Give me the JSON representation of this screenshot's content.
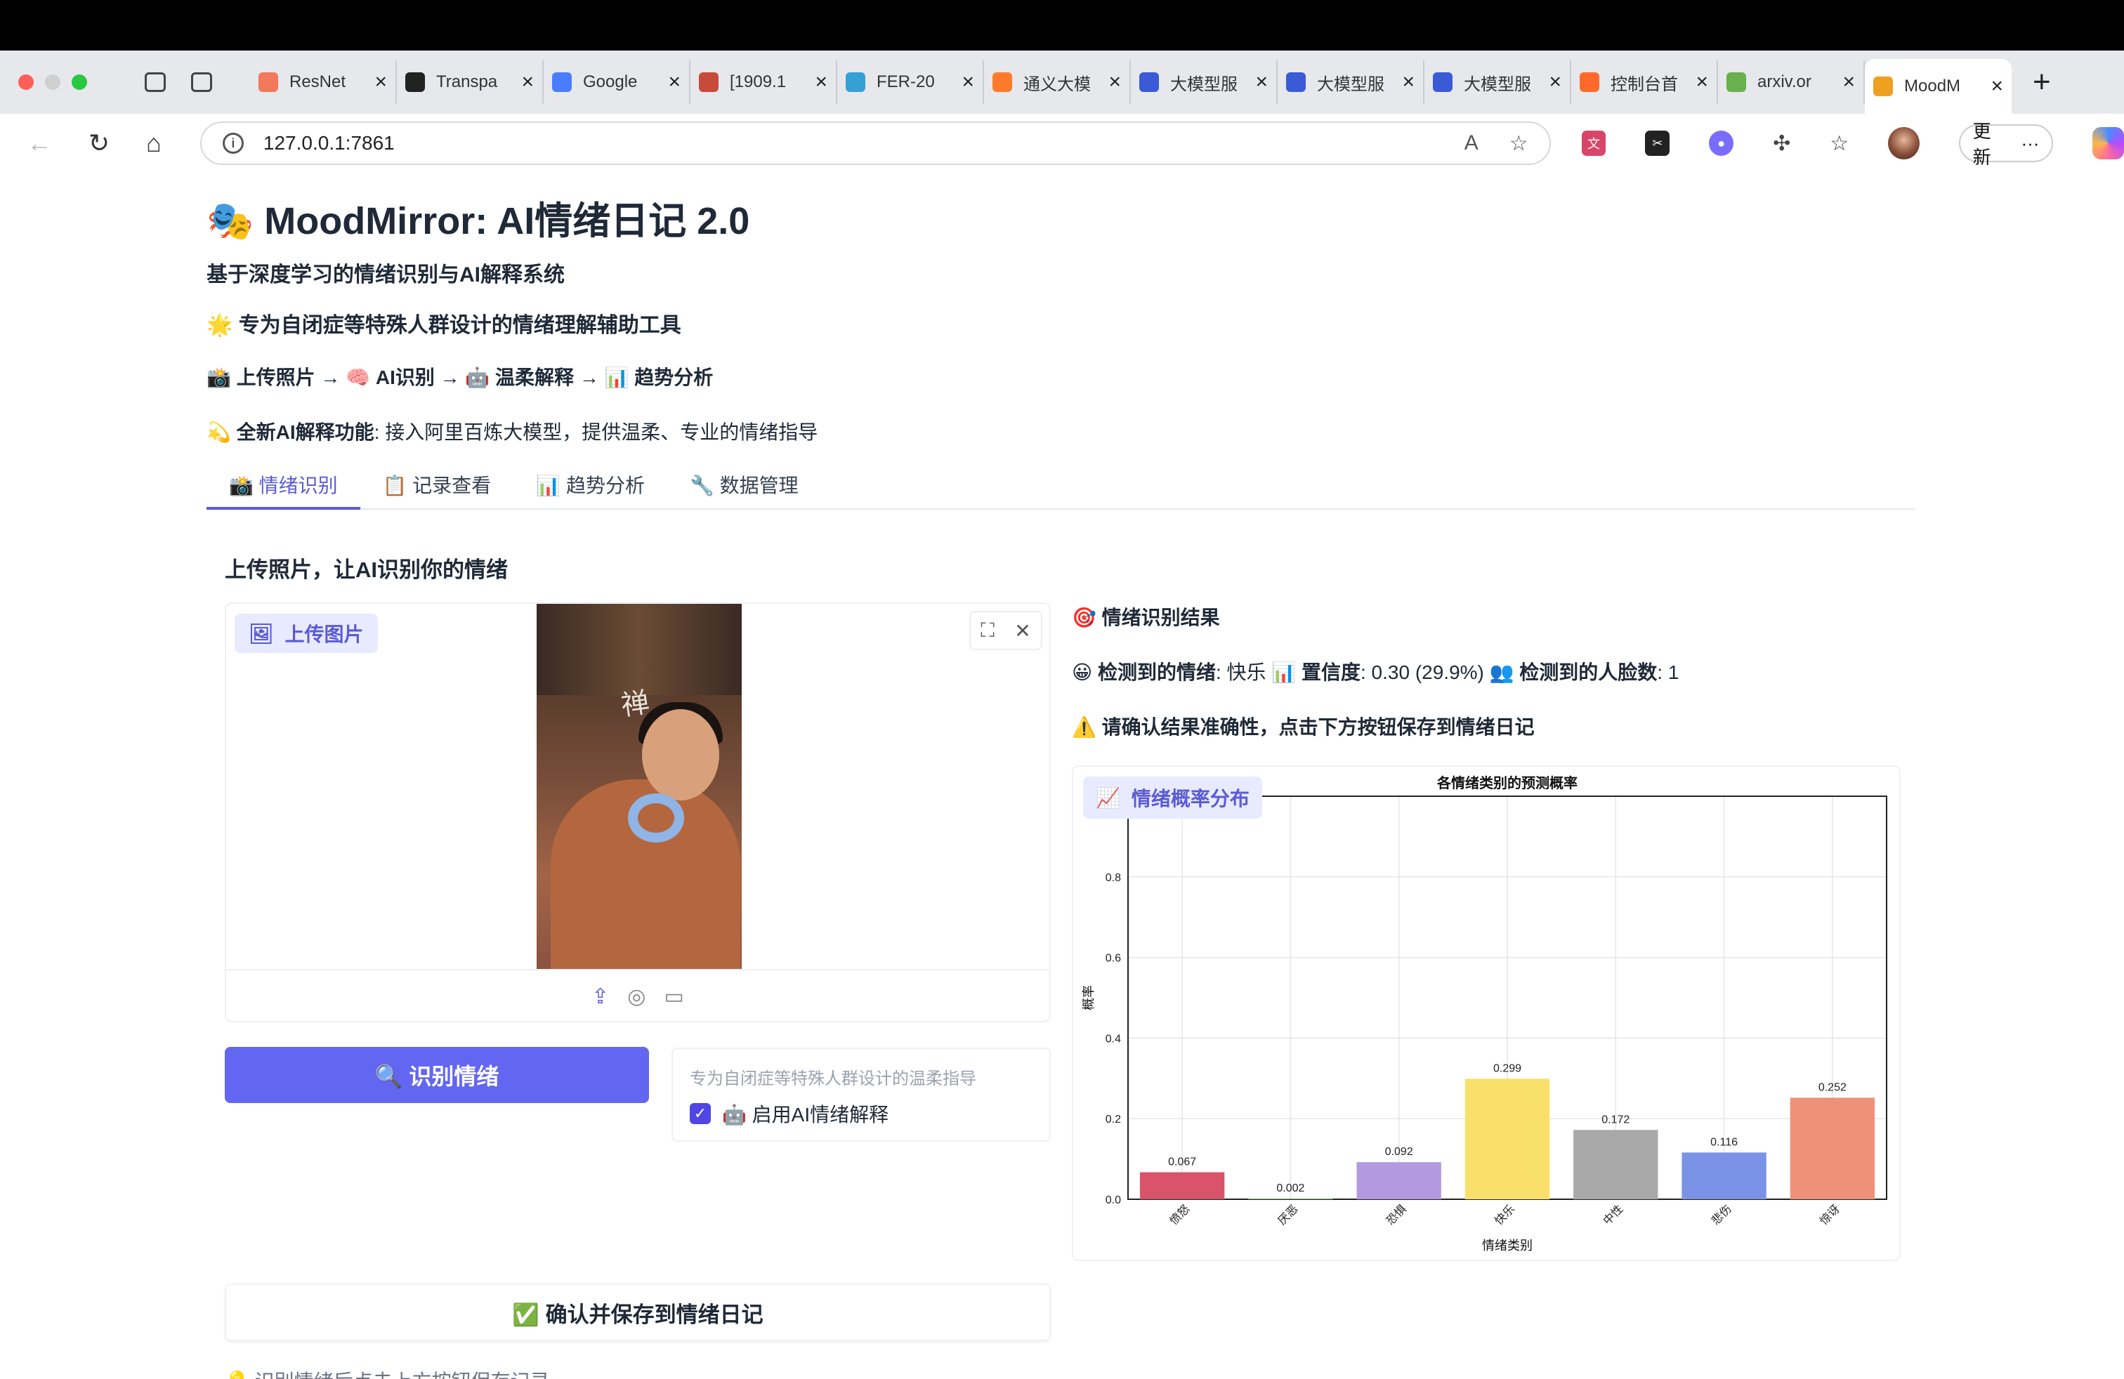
{
  "browser": {
    "tabs": [
      {
        "label": "ResNet",
        "color": "#f07a5a",
        "icon": "C"
      },
      {
        "label": "Transpa",
        "color": "#222222",
        "icon": "github"
      },
      {
        "label": "Google",
        "color": "#4a7cff",
        "icon": "spark"
      },
      {
        "label": "[1909.1",
        "color": "#c84a3a",
        "icon": "arxiv"
      },
      {
        "label": "FER-20",
        "color": "#35a0d6",
        "icon": "k"
      },
      {
        "label": "通义大模",
        "color": "#ff7a2a",
        "icon": "aliyun"
      },
      {
        "label": "大模型服",
        "color": "#3a5ad6",
        "icon": "bailian"
      },
      {
        "label": "大模型服",
        "color": "#3a5ad6",
        "icon": "bailian"
      },
      {
        "label": "大模型服",
        "color": "#3a5ad6",
        "icon": "bailian"
      },
      {
        "label": "控制台首",
        "color": "#ff6a2a",
        "icon": "aliyun"
      },
      {
        "label": "arxiv.or",
        "color": "#6ab04c",
        "icon": "arxiv"
      },
      {
        "label": "MoodM",
        "color": "#f0a020",
        "icon": "gradio",
        "active": true
      }
    ],
    "url": "127.0.0.1:7861",
    "update_label": "更新"
  },
  "app": {
    "title": "MoodMirror: AI情绪日记 2.0",
    "title_icon": "🎭",
    "subtitle": "基于深度学习的情绪识别与AI解释系统",
    "tagline": "🌟 专为自闭症等特殊人群设计的情绪理解辅助工具",
    "flow": "📸 上传照片 → 🧠 AI识别 → 🤖 温柔解释 → 📊 趋势分析",
    "feature_bold": "💫 全新AI解释功能",
    "feature_text": ": 接入阿里百炼大模型，提供温柔、专业的情绪指导"
  },
  "tabs": [
    {
      "label": "📸 情绪识别",
      "active": true
    },
    {
      "label": "📋 记录查看"
    },
    {
      "label": "📊 趋势分析"
    },
    {
      "label": "🔧 数据管理"
    }
  ],
  "section_title": "上传照片，让AI识别你的情绪",
  "upload": {
    "label": "上传图片"
  },
  "recognize_button": "🔍 识别情绪",
  "ai_option": {
    "hint": "专为自闭症等特殊人群设计的温柔指导",
    "checkbox_label": "🤖 启用AI情绪解释",
    "checked": true
  },
  "result": {
    "heading": "🎯 情绪识别结果",
    "emotion_label": "😀 检测到的情绪",
    "emotion_value": ": 快乐 ",
    "confidence_label": "📊 置信度",
    "confidence_value": ": 0.30 (29.9%) ",
    "faces_label": "👥 检测到的人脸数",
    "faces_value": ": 1",
    "warning": "⚠️ 请确认结果准确性，点击下方按钮保存到情绪日记"
  },
  "chart_label": "情绪概率分布",
  "chart_data": {
    "type": "bar",
    "title": "各情绪类别的预测概率",
    "xlabel": "情绪类别",
    "ylabel": "概率",
    "categories": [
      "愤怒",
      "厌恶",
      "恐惧",
      "快乐",
      "中性",
      "悲伤",
      "惊讶"
    ],
    "values": [
      0.067,
      0.002,
      0.092,
      0.299,
      0.172,
      0.116,
      0.252
    ],
    "value_labels": [
      "0.067",
      "0.002",
      "0.092",
      "0.299",
      "0.172",
      "0.116",
      "0.252"
    ],
    "colors": [
      "#d9546a",
      "#8fc07a",
      "#b39ae0",
      "#f9e06a",
      "#a9a9a9",
      "#7b93e6",
      "#ef9178"
    ],
    "ylim": [
      0,
      1.0
    ],
    "yticks": [
      "0.0",
      "0.2",
      "0.4",
      "0.6",
      "0.8"
    ],
    "grid": true
  },
  "save_button": "✅ 确认并保存到情绪日记",
  "bottom_note": "💡 识别情绪后点击上方按钮保存记录"
}
